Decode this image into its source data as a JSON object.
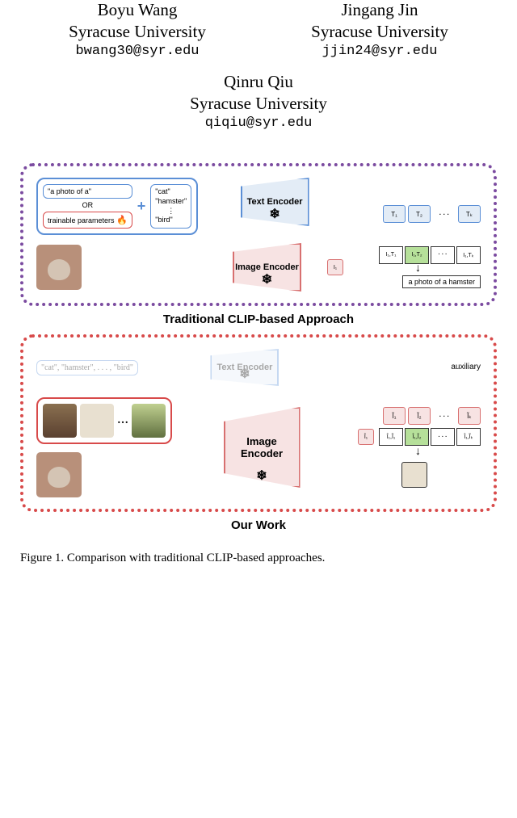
{
  "authors": {
    "col1": {
      "name": "Boyu Wang",
      "aff": "Syracuse University",
      "email": "bwang30@syr.edu"
    },
    "col2": {
      "name": "Jingang Jin",
      "aff": "Syracuse University",
      "email": "jjin24@syr.edu"
    },
    "col3": {
      "name": "Qinru Qiu",
      "aff": "Syracuse University",
      "email": "qiqiu@syr.edu"
    }
  },
  "fig": {
    "top_label": "Traditional CLIP-based Approach",
    "bot_label": "Our Work",
    "prompt_text": "\"a photo of a\"",
    "or_text": "OR",
    "trainable": "trainable parameters",
    "classes_line1": "\"cat\"",
    "classes_line2": "\"hamster\"",
    "classes_dots": "⋮",
    "classes_line3": "\"bird\"",
    "text_enc": "Text Encoder",
    "img_enc": "Image Encoder",
    "aux": "auxiliary",
    "classes_flat": "\"cat\", \"hamster\", . . . , \"bird\"",
    "T1": "T₁",
    "T2": "T₂",
    "TK": "Tₖ",
    "I1": "I₁",
    "IT1": "I₁,T₁",
    "IT2": "I₁,T₂",
    "ITK": "I₁,Tₖ",
    "result_text": "a photo of a hamster",
    "It1": "Ĩ₁",
    "It2": "Ĩ₂",
    "ItK": "Ĩₖ",
    "Ih1": "Î₁",
    "II1": "Î₁,Ĩ₁",
    "II2": "Î₁,Ĩ₂",
    "IIK": "Î₁,Ĩₖ",
    "dots": "· · ·"
  },
  "caption": {
    "line1": "Figure 1. Comparison with traditional CLIP-based approaches."
  }
}
